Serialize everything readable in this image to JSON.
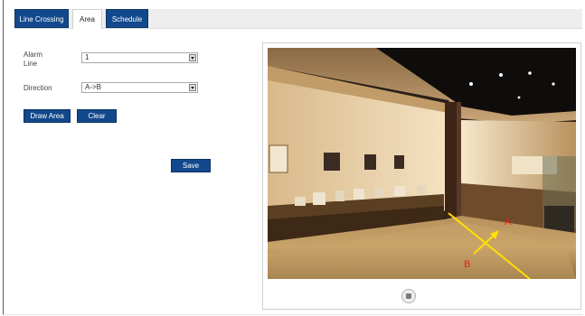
{
  "tabs": [
    {
      "label": "Line Crossing",
      "active": false
    },
    {
      "label": "Area",
      "active": true
    },
    {
      "label": "Schedule",
      "active": false
    }
  ],
  "form": {
    "alarm_line_label": "Alarm\nLine",
    "alarm_line_value": "1",
    "direction_label": "Direction",
    "direction_value": "A->B",
    "draw_area_label": "Draw Area",
    "clear_label": "Clear",
    "save_label": "Save"
  },
  "preview": {
    "line_end_labels": {
      "a": "A",
      "b": "B"
    },
    "line_color": "#ffe100",
    "label_color": "#e8231b",
    "control_icon": "stop-icon"
  },
  "colors": {
    "accent": "#12498c",
    "tab_bar": "#eeeeee"
  }
}
